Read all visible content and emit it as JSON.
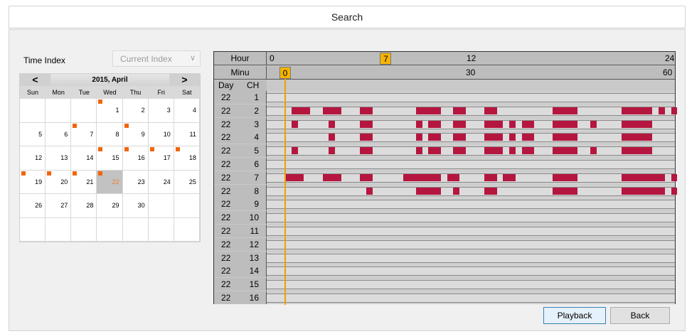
{
  "window": {
    "title": "Search"
  },
  "time_index": {
    "label": "Time Index",
    "value": "Current Index"
  },
  "calendar": {
    "month_label": "2015, April",
    "prev": "<",
    "next": ">",
    "weekdays": [
      "Sun",
      "Mon",
      "Tue",
      "Wed",
      "Thu",
      "Fri",
      "Sat"
    ],
    "weeks": [
      [
        null,
        null,
        null,
        "1",
        "2",
        "3",
        "4"
      ],
      [
        "5",
        "6",
        "7",
        "8",
        "9",
        "10",
        "11"
      ],
      [
        "12",
        "13",
        "14",
        "15",
        "16",
        "17",
        "18"
      ],
      [
        "19",
        "20",
        "21",
        "22",
        "23",
        "24",
        "25"
      ],
      [
        "26",
        "27",
        "28",
        "29",
        "30",
        null,
        null
      ],
      [
        null,
        null,
        null,
        null,
        null,
        null,
        null
      ]
    ],
    "days_with_recordings": [
      "1",
      "7",
      "9",
      "15",
      "16",
      "17",
      "18",
      "19",
      "20",
      "21",
      "22"
    ],
    "selected_day": "22",
    "mark_color": "#f0660b"
  },
  "timeline": {
    "hour_label": "Hour",
    "minu_label": "Minu",
    "day_col": "Day",
    "ch_col": "CH",
    "hour_ticks": [
      {
        "label": "0",
        "frac": 0.0
      },
      {
        "label": "12",
        "frac": 0.5
      },
      {
        "label": "24",
        "frac": 1.0
      }
    ],
    "hour_pointer": "7",
    "hour_pointer_frac": 0.2917,
    "minu_ticks": [
      {
        "label": "30",
        "frac": 0.5
      },
      {
        "label": "60",
        "frac": 1.0
      }
    ],
    "minu_pointer": "0",
    "recording_color": "#b5163f",
    "rows": [
      {
        "day": "22",
        "ch": "1",
        "segments": []
      },
      {
        "day": "22",
        "ch": "2",
        "segments": [
          [
            1,
            4
          ],
          [
            6,
            9
          ],
          [
            12,
            14
          ],
          [
            21,
            25
          ],
          [
            27,
            29
          ],
          [
            32,
            34
          ],
          [
            43,
            47
          ],
          [
            54,
            59
          ],
          [
            60,
            61
          ],
          [
            62,
            63
          ]
        ]
      },
      {
        "day": "22",
        "ch": "3",
        "segments": [
          [
            1,
            2
          ],
          [
            7,
            8
          ],
          [
            12,
            14
          ],
          [
            21,
            22
          ],
          [
            23,
            25
          ],
          [
            27,
            29
          ],
          [
            32,
            35
          ],
          [
            36,
            37
          ],
          [
            38,
            40
          ],
          [
            43,
            47
          ],
          [
            49,
            50
          ],
          [
            54,
            59
          ]
        ]
      },
      {
        "day": "22",
        "ch": "4",
        "segments": [
          [
            7,
            8
          ],
          [
            12,
            14
          ],
          [
            21,
            22
          ],
          [
            23,
            25
          ],
          [
            27,
            29
          ],
          [
            32,
            35
          ],
          [
            36,
            37
          ],
          [
            38,
            40
          ],
          [
            43,
            47
          ],
          [
            54,
            59
          ]
        ]
      },
      {
        "day": "22",
        "ch": "5",
        "segments": [
          [
            1,
            2
          ],
          [
            7,
            8
          ],
          [
            12,
            14
          ],
          [
            21,
            22
          ],
          [
            23,
            25
          ],
          [
            27,
            29
          ],
          [
            32,
            35
          ],
          [
            36,
            37
          ],
          [
            38,
            40
          ],
          [
            43,
            47
          ],
          [
            49,
            50
          ],
          [
            54,
            59
          ]
        ]
      },
      {
        "day": "22",
        "ch": "6",
        "segments": []
      },
      {
        "day": "22",
        "ch": "7",
        "segments": [
          [
            0,
            3
          ],
          [
            6,
            9
          ],
          [
            12,
            14
          ],
          [
            19,
            25
          ],
          [
            26,
            28
          ],
          [
            32,
            34
          ],
          [
            35,
            37
          ],
          [
            43,
            47
          ],
          [
            54,
            61
          ],
          [
            62,
            63
          ]
        ]
      },
      {
        "day": "22",
        "ch": "8",
        "segments": [
          [
            13,
            14
          ],
          [
            21,
            25
          ],
          [
            27,
            28
          ],
          [
            32,
            34
          ],
          [
            43,
            47
          ],
          [
            54,
            61
          ],
          [
            62,
            63
          ]
        ]
      },
      {
        "day": "22",
        "ch": "9",
        "segments": []
      },
      {
        "day": "22",
        "ch": "10",
        "segments": []
      },
      {
        "day": "22",
        "ch": "11",
        "segments": []
      },
      {
        "day": "22",
        "ch": "12",
        "segments": []
      },
      {
        "day": "22",
        "ch": "13",
        "segments": []
      },
      {
        "day": "22",
        "ch": "14",
        "segments": []
      },
      {
        "day": "22",
        "ch": "15",
        "segments": []
      },
      {
        "day": "22",
        "ch": "16",
        "segments": []
      }
    ]
  },
  "buttons": {
    "playback": "Playback",
    "back": "Back"
  }
}
